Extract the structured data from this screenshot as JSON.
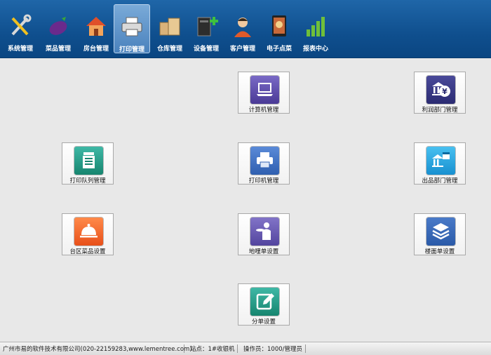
{
  "toolbar": {
    "items": [
      {
        "label": "系统管理",
        "icon": "tools-icon"
      },
      {
        "label": "菜品管理",
        "icon": "eggplant-icon"
      },
      {
        "label": "房台管理",
        "icon": "house-icon"
      },
      {
        "label": "打印管理",
        "icon": "printer-icon",
        "active": true
      },
      {
        "label": "仓库管理",
        "icon": "boxes-icon"
      },
      {
        "label": "设备管理",
        "icon": "device-icon"
      },
      {
        "label": "客户管理",
        "icon": "customer-icon"
      },
      {
        "label": "电子点菜",
        "icon": "tablet-menu-icon"
      },
      {
        "label": "报表中心",
        "icon": "bar-chart-icon"
      }
    ]
  },
  "tiles": {
    "computer": "计算机管理",
    "profit_dept": "利润部门管理",
    "print_queue": "打印队列管理",
    "printer": "打印机管理",
    "dish_dept": "出品部门管理",
    "area_dish": "台区菜品设置",
    "waiter_slip": "地哩单设置",
    "floor_slip": "楼面单设置",
    "split_slip": "分单设置"
  },
  "status": {
    "company": "广州市易的软件技术有限公司(020-22159283,www.lementree.com)",
    "station": "站点：1#收银机",
    "operator": "操作员：1000/管理员"
  },
  "colors": {
    "toolbar_blue": "#0f4f8e",
    "tile_purple": "#5b4aa6",
    "tile_blue": "#3f73c6",
    "tile_teal": "#1f9b8a",
    "tile_orange": "#f06a2a",
    "tile_cyan": "#24a4e0"
  }
}
